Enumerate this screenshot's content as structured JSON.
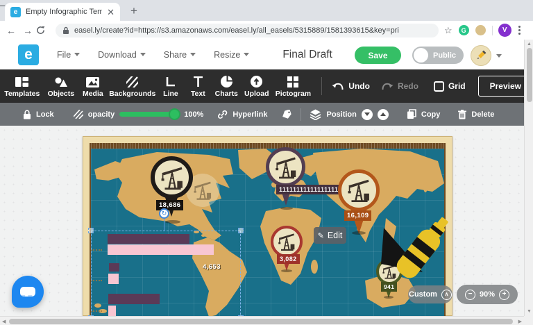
{
  "browser": {
    "tab_title": "Empty Infographic Template",
    "tab_favicon_letter": "e",
    "new_tab": "+",
    "window": {
      "minimize": "–",
      "maximize": "□",
      "close": "×"
    },
    "nav": {
      "back": "←",
      "forward": "→"
    },
    "url": "easel.ly/create?id=https://s3.amazonaws.com/easel.ly/all_easels/5315889/1581393615&key=pri",
    "extension_letter": "G",
    "profile_initial": "V"
  },
  "header": {
    "logo_letter": "e",
    "menu_file": "File",
    "menu_download": "Download",
    "menu_share": "Share",
    "menu_resize": "Resize",
    "doc_title": "Final Draft",
    "save_label": "Save",
    "public_label": "Public"
  },
  "toolbar": {
    "templates": "Templates",
    "objects": "Objects",
    "media": "Media",
    "backgrounds": "Backgrounds",
    "line": "Line",
    "text": "Text",
    "charts": "Charts",
    "upload": "Upload",
    "pictogram": "Pictogram",
    "undo": "Undo",
    "redo": "Redo",
    "grid": "Grid",
    "preview": "Preview"
  },
  "subtoolbar": {
    "lock": "Lock",
    "opacity": "opacity",
    "opacity_value": "100%",
    "hyperlink": "Hyperlink",
    "position": "Position",
    "copy": "Copy",
    "delete": "Delete"
  },
  "canvas": {
    "edit_button": "Edit",
    "zoom_mode": "Custom",
    "zoom_level": "90%",
    "zoom_out": "−",
    "zoom_in": "+",
    "annotation": "4,653",
    "pins": [
      {
        "region": "north-america",
        "value": "18,686",
        "color": "#1f1b18"
      },
      {
        "region": "europe",
        "value": "11111111111111111",
        "color": "#533e52"
      },
      {
        "region": "asia",
        "value": "16,109",
        "color": "#b3571b"
      },
      {
        "region": "africa",
        "value": "3,082",
        "color": "#a93830"
      },
      {
        "region": "australia",
        "value": "941",
        "color": "#4c5a23"
      }
    ],
    "bar_chart": {
      "rows": [
        {
          "color": "#5a3a57",
          "width": 118
        },
        {
          "color": "#f8c6d2",
          "width": 153
        },
        {
          "color": "#5a3a57",
          "width": 15
        },
        {
          "color": "#f8c6d2",
          "width": 15
        },
        {
          "color": "#5a3a57",
          "width": 74
        },
        {
          "color": "#f8c6d2",
          "width": 11
        }
      ]
    },
    "colors": {
      "ocean": "#19708a",
      "land": "#d9ab60",
      "frame": "#eedcab",
      "accent_green": "#35bf66"
    }
  }
}
